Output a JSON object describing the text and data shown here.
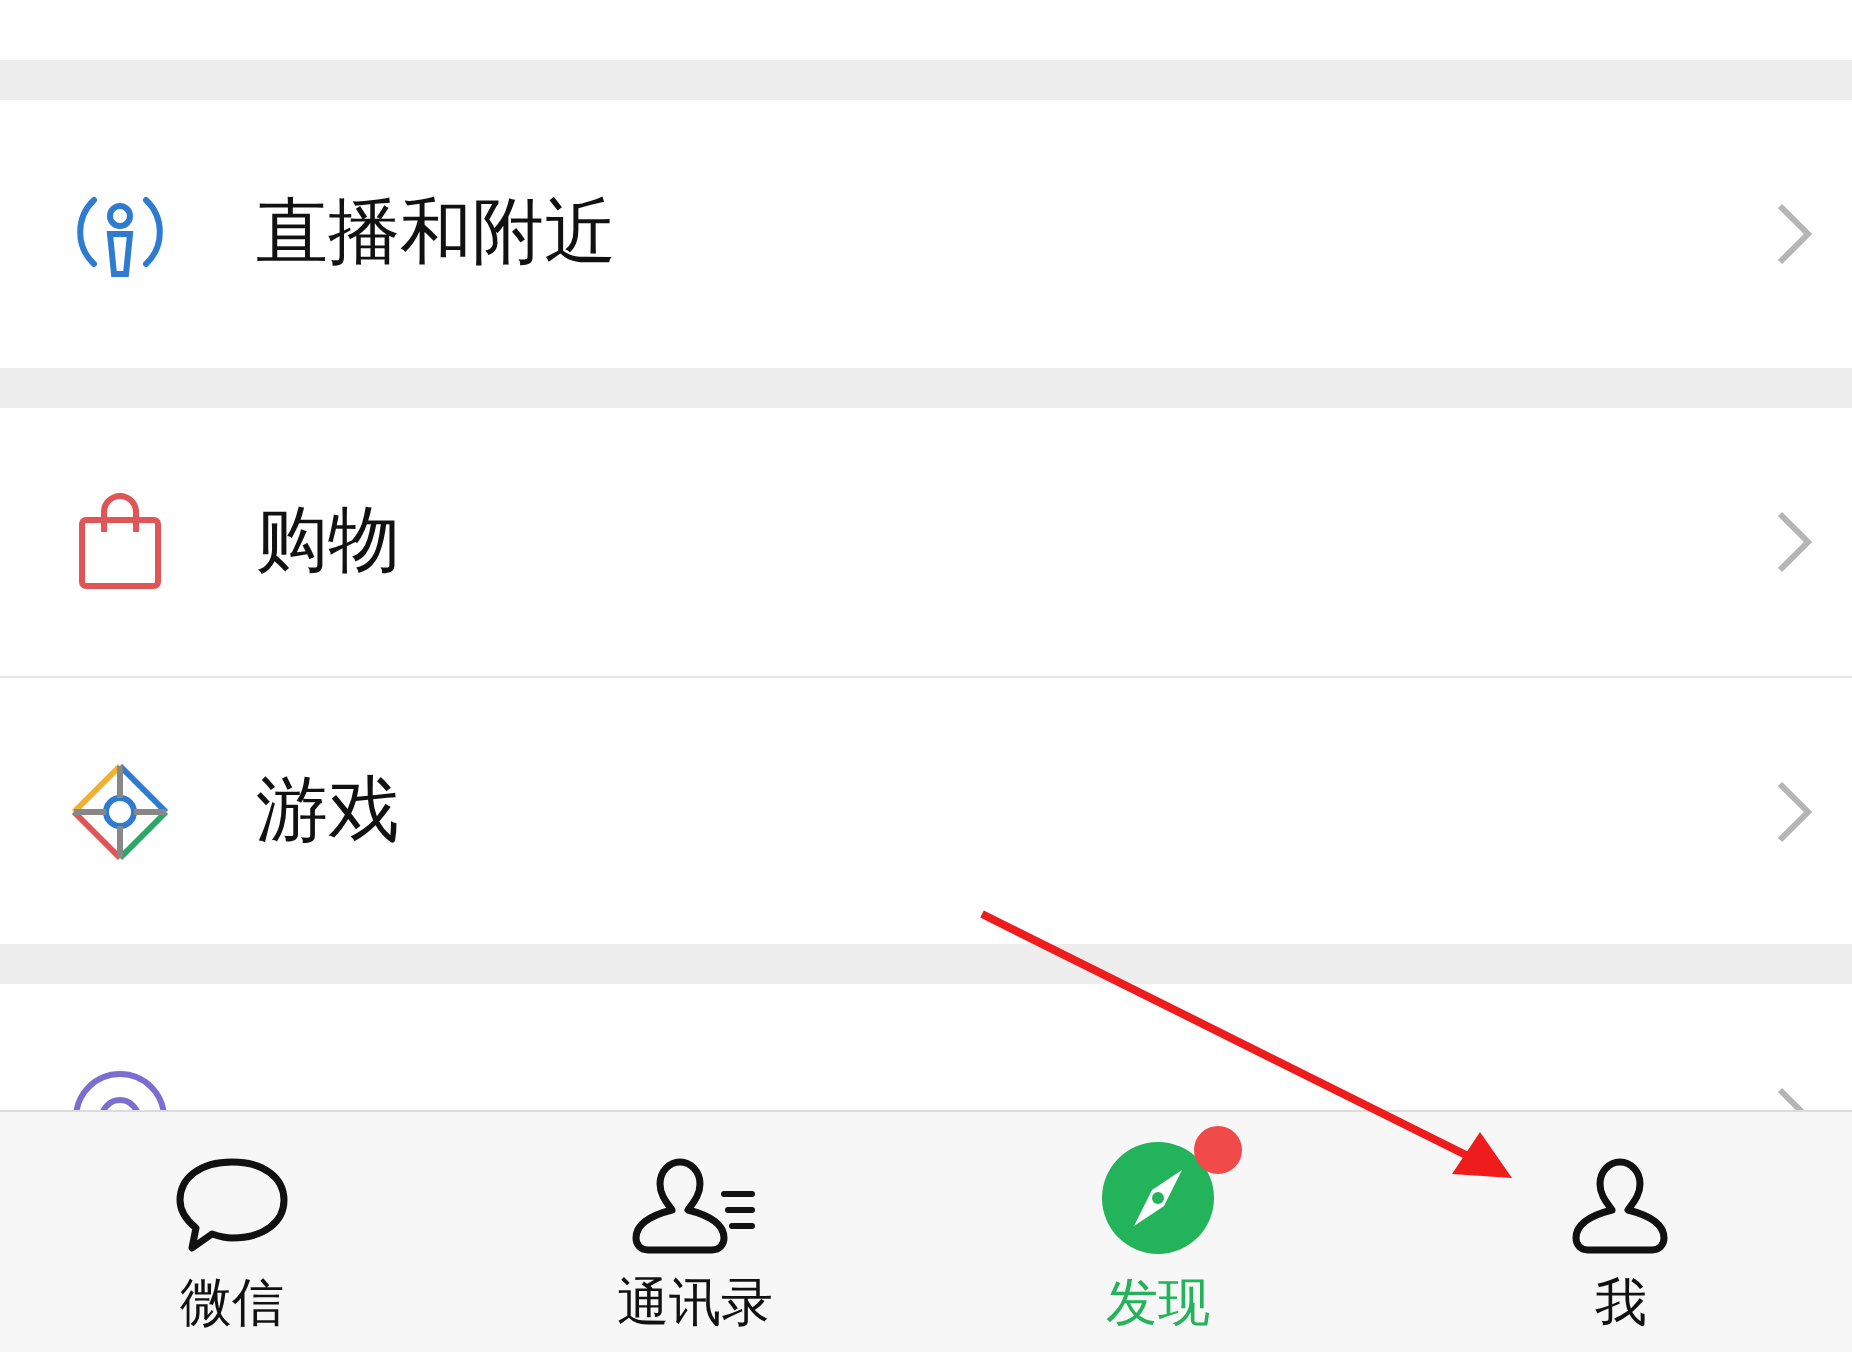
{
  "groups": [
    {
      "items": [
        {
          "kind": "live",
          "label": "直播和附近"
        }
      ]
    },
    {
      "items": [
        {
          "kind": "shop",
          "label": "购物"
        },
        {
          "kind": "game",
          "label": "游戏"
        }
      ]
    },
    {
      "items": [
        {
          "kind": "mini"
        }
      ]
    }
  ],
  "tabs": [
    {
      "kind": "chat",
      "label": "微信",
      "selected": false,
      "dot": false
    },
    {
      "kind": "contacts",
      "label": "通讯录",
      "selected": false,
      "dot": false
    },
    {
      "kind": "discover",
      "label": "发现",
      "selected": true,
      "dot": true
    },
    {
      "kind": "me",
      "label": "我",
      "selected": false,
      "dot": false
    }
  ]
}
